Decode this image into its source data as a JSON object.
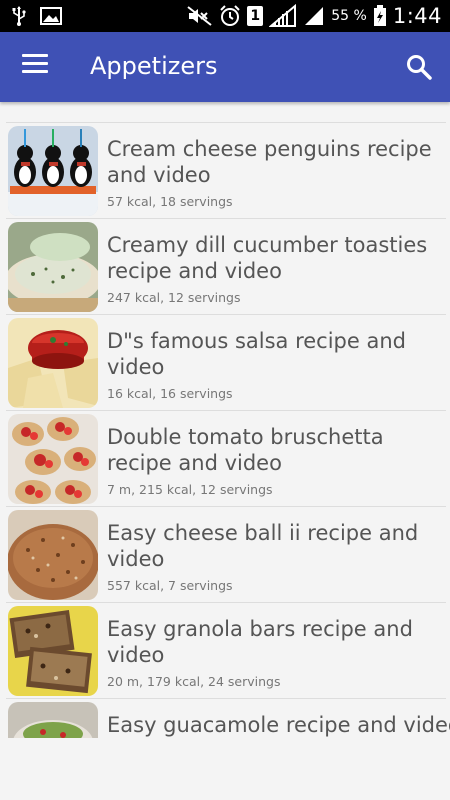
{
  "status_bar": {
    "battery_percent": "55 %",
    "time": "1:44",
    "sim_label": "1",
    "left_icons": [
      "usb-icon",
      "image-icon"
    ],
    "right_icons": [
      "mute-icon",
      "alarm-icon",
      "sim-icon",
      "signal-icon",
      "signal-icon",
      "battery-icon"
    ]
  },
  "app_bar": {
    "title": "Appetizers",
    "menu_icon": "hamburger-menu-icon",
    "search_icon": "search-icon",
    "background": "#3f51b5"
  },
  "recipes": [
    {
      "title": "Cream cheese penguins recipe and video",
      "meta": "57 kcal, 18 servings"
    },
    {
      "title": "Creamy dill cucumber toasties recipe and video",
      "meta": "247 kcal, 12 servings"
    },
    {
      "title": "D\"s famous salsa recipe and video",
      "meta": "16 kcal, 16 servings"
    },
    {
      "title": "Double tomato bruschetta recipe and video",
      "meta": "7 m, 215 kcal, 12 servings"
    },
    {
      "title": "Easy cheese ball ii recipe and video",
      "meta": "557 kcal, 7 servings"
    },
    {
      "title": "Easy granola bars recipe and video",
      "meta": "20 m, 179 kcal, 24 servings"
    },
    {
      "title": "Easy guacamole recipe and video",
      "meta": ""
    }
  ]
}
